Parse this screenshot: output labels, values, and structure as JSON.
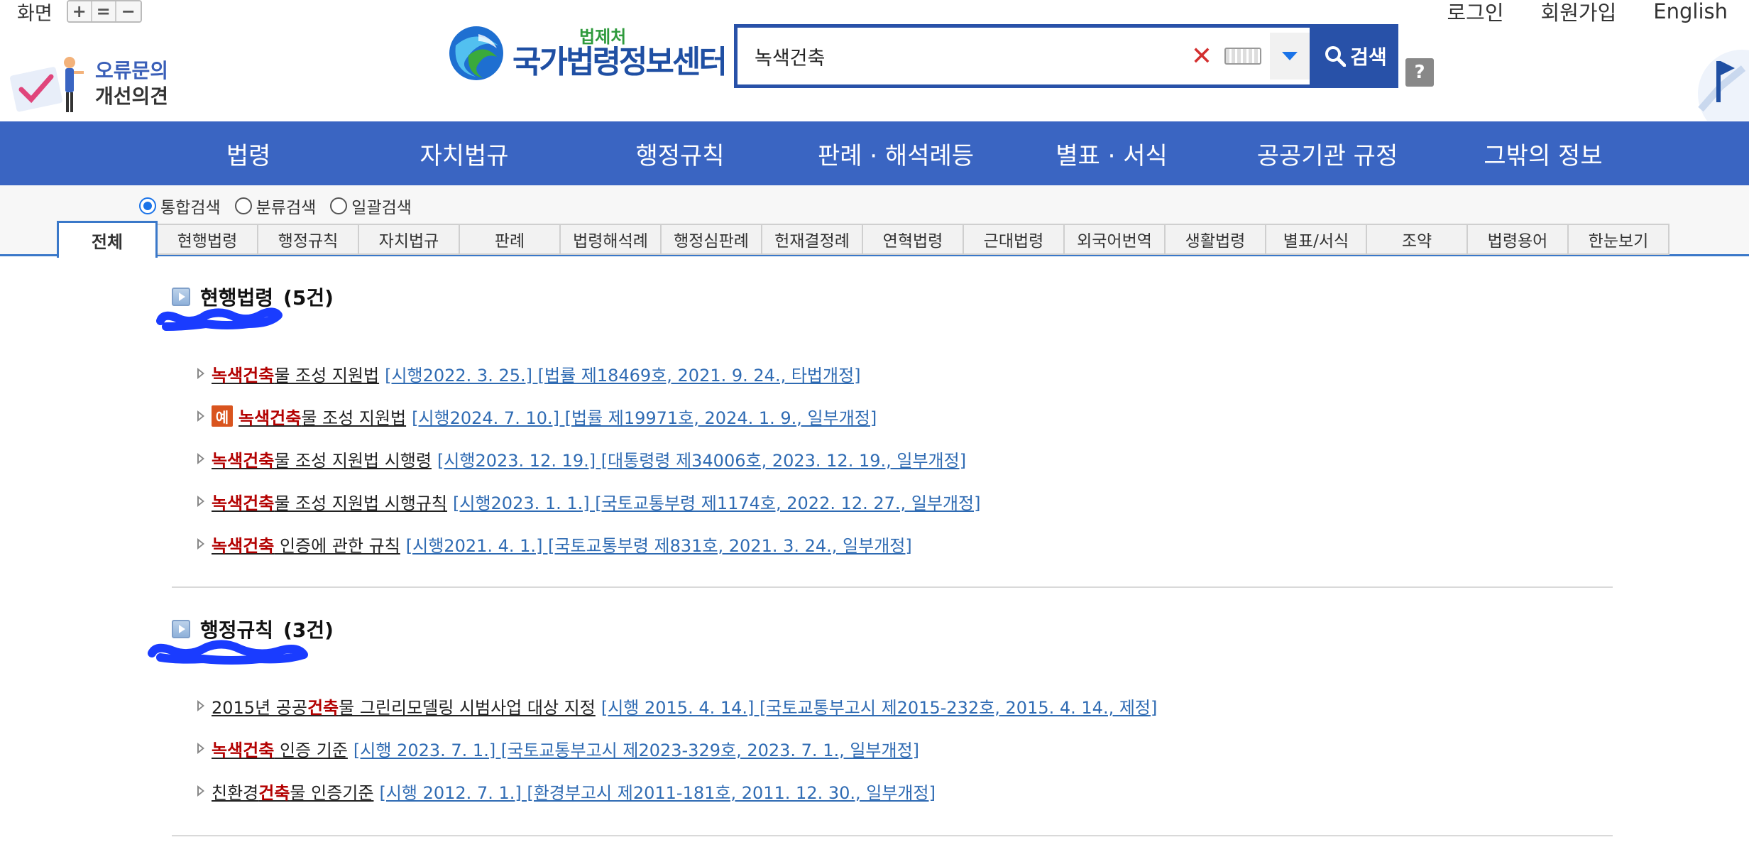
{
  "util": {
    "screen_label": "화면",
    "zoom_in": "+",
    "zoom_reset": "=",
    "zoom_out": "−",
    "login": "로그인",
    "signup": "회원가입",
    "english": "English"
  },
  "feedback": {
    "line1": "오류문의",
    "line2": "개선의견"
  },
  "logo": {
    "sub": "법제처",
    "main": "국가법령정보센터"
  },
  "search": {
    "value": "녹색건축",
    "clear": "✕",
    "button": "검색",
    "help": "?"
  },
  "nav": [
    "법령",
    "자치법규",
    "행정규칙",
    "판례 · 해석례등",
    "별표 · 서식",
    "공공기관 규정",
    "그밖의 정보"
  ],
  "search_types": [
    {
      "label": "통합검색",
      "checked": true
    },
    {
      "label": "분류검색",
      "checked": false
    },
    {
      "label": "일괄검색",
      "checked": false
    }
  ],
  "tabs": [
    "전체",
    "현행법령",
    "행정규칙",
    "자치법규",
    "판례",
    "법령해석례",
    "행정심판례",
    "헌재결정례",
    "연혁법령",
    "근대법령",
    "외국어번역",
    "생활법령",
    "별표/서식",
    "조약",
    "법령용어",
    "한눈보기"
  ],
  "colors": {
    "accent": "#3a65c2",
    "highlight": "#b30000",
    "meta": "#2f6bb3",
    "badge": "#d9541e"
  },
  "sections": [
    {
      "title": "현행법령",
      "count": "(5건)",
      "items": [
        {
          "badge": "",
          "pre": "",
          "hl": "녹색건축",
          "post": "물 조성 지원법",
          "meta": "[시행2022. 3. 25.] [법률 제18469호, 2021. 9. 24., 타법개정]"
        },
        {
          "badge": "예",
          "pre": "",
          "hl": "녹색건축",
          "post": "물 조성 지원법",
          "meta": "[시행2024. 7. 10.] [법률 제19971호, 2024. 1. 9., 일부개정]"
        },
        {
          "badge": "",
          "pre": "",
          "hl": "녹색건축",
          "post": "물 조성 지원법 시행령",
          "meta": "[시행2023. 12. 19.] [대통령령 제34006호, 2023. 12. 19., 일부개정]"
        },
        {
          "badge": "",
          "pre": "",
          "hl": "녹색건축",
          "post": "물 조성 지원법 시행규칙",
          "meta": "[시행2023. 1. 1.] [국토교통부령 제1174호, 2022. 12. 27., 일부개정]"
        },
        {
          "badge": "",
          "pre": "",
          "hl": "녹색건축",
          "post": " 인증에 관한 규칙",
          "meta": "[시행2021. 4. 1.] [국토교통부령 제831호, 2021. 3. 24., 일부개정]"
        }
      ]
    },
    {
      "title": "행정규칙",
      "count": "(3건)",
      "items": [
        {
          "badge": "",
          "pre": "2015년 공공",
          "hl": "건축",
          "post": "물 그린리모델링 시범사업 대상 지정",
          "meta": "[시행 2015. 4. 14.] [국토교통부고시 제2015-232호, 2015. 4. 14., 제정]"
        },
        {
          "badge": "",
          "pre": "",
          "hl": "녹색건축",
          "post": " 인증 기준",
          "meta": "[시행 2023. 7. 1.] [국토교통부고시 제2023-329호, 2023. 7. 1., 일부개정]"
        },
        {
          "badge": "",
          "pre": "친환경",
          "hl": "건축",
          "post": "물 인증기준",
          "meta": "[시행 2012. 7. 1.] [환경부고시 제2011-181호, 2011. 12. 30., 일부개정]"
        }
      ]
    }
  ]
}
